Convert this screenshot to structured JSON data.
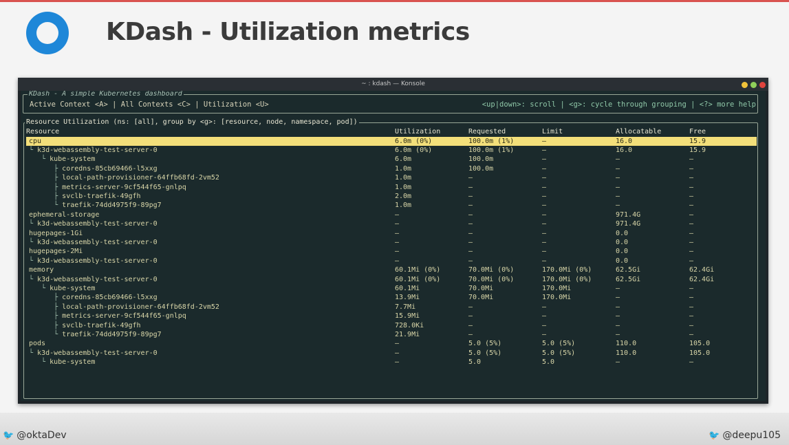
{
  "slide": {
    "title": "KDash - Utilization metrics",
    "twitter_left": "@oktaDev",
    "twitter_right": "@deepu105"
  },
  "window": {
    "title": "~ : kdash — Konsole"
  },
  "kdash": {
    "app_title": "KDash - A simple Kubernetes dashboard",
    "tabs": "Active Context <A> | All Contexts <C> | Utilization <U>",
    "help": "<up|down>: scroll | <g>: cycle through grouping | <?> more help",
    "panel_title": "Resource Utilization (ns: [all], group by <g>: [resource, node, namespace, pod])",
    "columns": [
      "Resource",
      "Utilization",
      "Requested",
      "Limit",
      "Allocatable",
      "Free"
    ],
    "rows": [
      {
        "prefix": "",
        "name": "cpu",
        "util": "6.0m (0%)",
        "req": "100.0m (1%)",
        "limit": "—",
        "alloc": "16.0",
        "free": "15.9",
        "selected": true
      },
      {
        "prefix": "└ ",
        "name": "k3d-webassembly-test-server-0",
        "util": "6.0m (0%)",
        "req": "100.0m (1%)",
        "limit": "—",
        "alloc": "16.0",
        "free": "15.9"
      },
      {
        "prefix": "   └ ",
        "name": "kube-system",
        "util": "6.0m",
        "req": "100.0m",
        "limit": "—",
        "alloc": "—",
        "free": "—"
      },
      {
        "prefix": "      ├ ",
        "name": "coredns-85cb69466-l5xxg",
        "util": "1.0m",
        "req": "100.0m",
        "limit": "—",
        "alloc": "—",
        "free": "—"
      },
      {
        "prefix": "      ├ ",
        "name": "local-path-provisioner-64ffb68fd-2vm52",
        "util": "1.0m",
        "req": "—",
        "limit": "—",
        "alloc": "—",
        "free": "—"
      },
      {
        "prefix": "      ├ ",
        "name": "metrics-server-9cf544f65-gnlpq",
        "util": "1.0m",
        "req": "—",
        "limit": "—",
        "alloc": "—",
        "free": "—"
      },
      {
        "prefix": "      ├ ",
        "name": "svclb-traefik-49gfh",
        "util": "2.0m",
        "req": "—",
        "limit": "—",
        "alloc": "—",
        "free": "—"
      },
      {
        "prefix": "      └ ",
        "name": "traefik-74dd4975f9-89pg7",
        "util": "1.0m",
        "req": "—",
        "limit": "—",
        "alloc": "—",
        "free": "—"
      },
      {
        "prefix": "",
        "name": "ephemeral-storage",
        "util": "—",
        "req": "—",
        "limit": "—",
        "alloc": "971.4G",
        "free": "—"
      },
      {
        "prefix": "└ ",
        "name": "k3d-webassembly-test-server-0",
        "util": "—",
        "req": "—",
        "limit": "—",
        "alloc": "971.4G",
        "free": "—"
      },
      {
        "prefix": "",
        "name": "hugepages-1Gi",
        "util": "—",
        "req": "—",
        "limit": "—",
        "alloc": "0.0",
        "free": "—"
      },
      {
        "prefix": "└ ",
        "name": "k3d-webassembly-test-server-0",
        "util": "—",
        "req": "—",
        "limit": "—",
        "alloc": "0.0",
        "free": "—"
      },
      {
        "prefix": "",
        "name": "hugepages-2Mi",
        "util": "—",
        "req": "—",
        "limit": "—",
        "alloc": "0.0",
        "free": "—"
      },
      {
        "prefix": "└ ",
        "name": "k3d-webassembly-test-server-0",
        "util": "—",
        "req": "—",
        "limit": "—",
        "alloc": "0.0",
        "free": "—"
      },
      {
        "prefix": "",
        "name": "memory",
        "util": "60.1Mi (0%)",
        "req": "70.0Mi (0%)",
        "limit": "170.0Mi (0%)",
        "alloc": "62.5Gi",
        "free": "62.4Gi"
      },
      {
        "prefix": "└ ",
        "name": "k3d-webassembly-test-server-0",
        "util": "60.1Mi (0%)",
        "req": "70.0Mi (0%)",
        "limit": "170.0Mi (0%)",
        "alloc": "62.5Gi",
        "free": "62.4Gi"
      },
      {
        "prefix": "   └ ",
        "name": "kube-system",
        "util": "60.1Mi",
        "req": "70.0Mi",
        "limit": "170.0Mi",
        "alloc": "—",
        "free": "—"
      },
      {
        "prefix": "      ├ ",
        "name": "coredns-85cb69466-l5xxg",
        "util": "13.9Mi",
        "req": "70.0Mi",
        "limit": "170.0Mi",
        "alloc": "—",
        "free": "—"
      },
      {
        "prefix": "      ├ ",
        "name": "local-path-provisioner-64ffb68fd-2vm52",
        "util": "7.7Mi",
        "req": "—",
        "limit": "—",
        "alloc": "—",
        "free": "—"
      },
      {
        "prefix": "      ├ ",
        "name": "metrics-server-9cf544f65-gnlpq",
        "util": "15.9Mi",
        "req": "—",
        "limit": "—",
        "alloc": "—",
        "free": "—"
      },
      {
        "prefix": "      ├ ",
        "name": "svclb-traefik-49gfh",
        "util": "728.0Ki",
        "req": "—",
        "limit": "—",
        "alloc": "—",
        "free": "—"
      },
      {
        "prefix": "      └ ",
        "name": "traefik-74dd4975f9-89pg7",
        "util": "21.9Mi",
        "req": "—",
        "limit": "—",
        "alloc": "—",
        "free": "—"
      },
      {
        "prefix": "",
        "name": "pods",
        "util": "—",
        "req": "5.0 (5%)",
        "limit": "5.0 (5%)",
        "alloc": "110.0",
        "free": "105.0"
      },
      {
        "prefix": "└ ",
        "name": "k3d-webassembly-test-server-0",
        "util": "—",
        "req": "5.0 (5%)",
        "limit": "5.0 (5%)",
        "alloc": "110.0",
        "free": "105.0"
      },
      {
        "prefix": "   └ ",
        "name": "kube-system",
        "util": "—",
        "req": "5.0",
        "limit": "5.0",
        "alloc": "—",
        "free": "—"
      }
    ]
  },
  "colors": {
    "accent": "#1e87d8",
    "selection": "#f3df7a",
    "terminal_bg": "#1b2a2c",
    "twitter": "#1da1f2"
  },
  "icons": {
    "logo": "okta-ring-logo",
    "twitter": "twitter-bird-icon"
  }
}
